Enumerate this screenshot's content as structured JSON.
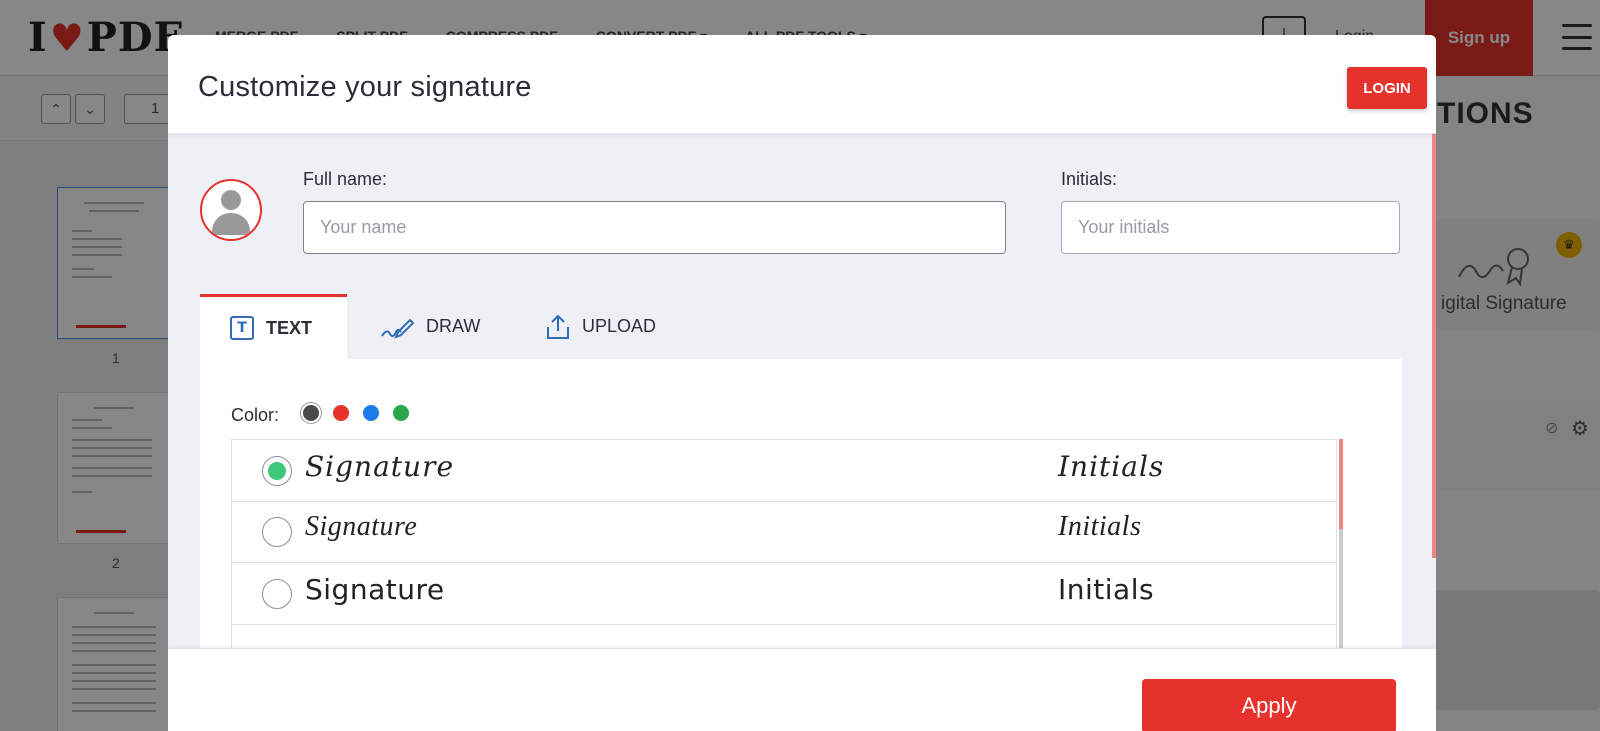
{
  "app": {
    "logo_text_left": "I",
    "logo_text_right": "PDF",
    "nav": [
      "MERGE PDF",
      "SPLIT PDF",
      "COMPRESS PDF",
      "CONVERT PDF ▾",
      "ALL PDF TOOLS ▾"
    ],
    "login_label": "Login",
    "signup_label": "Sign up",
    "accent_color": "#e5322d"
  },
  "viewer": {
    "page_input_value": "1",
    "thumbnails": [
      {
        "number": "1",
        "selected": true
      },
      {
        "number": "2",
        "selected": false
      },
      {
        "number": "",
        "selected": false
      }
    ]
  },
  "right_panel": {
    "title_fragment": "TIONS",
    "card_label": "igital Signature",
    "premium_icon": "crown-icon"
  },
  "modal": {
    "title": "Customize your signature",
    "login_button": "LOGIN",
    "full_name": {
      "label": "Full name:",
      "placeholder": "Your name",
      "value": ""
    },
    "initials": {
      "label": "Initials:",
      "placeholder": "Your initials",
      "value": ""
    },
    "tabs": [
      {
        "label": "TEXT",
        "icon": "text-box-icon",
        "active": true
      },
      {
        "label": "DRAW",
        "icon": "pen-signature-icon",
        "active": false
      },
      {
        "label": "UPLOAD",
        "icon": "upload-icon",
        "active": false
      }
    ],
    "color_label": "Color:",
    "colors": [
      {
        "name": "black",
        "hex": "#4a4a4a",
        "selected": true
      },
      {
        "name": "red",
        "hex": "#e5322d",
        "selected": false
      },
      {
        "name": "blue",
        "hex": "#1e7ae6",
        "selected": false
      },
      {
        "name": "green",
        "hex": "#2aa84a",
        "selected": false
      }
    ],
    "signature_options": [
      {
        "signature": "Signature",
        "initials": "Initials",
        "checked": true
      },
      {
        "signature": "Signature",
        "initials": "Initials",
        "checked": false
      },
      {
        "signature": "Signature",
        "initials": "Initials",
        "checked": false
      }
    ],
    "apply_button": "Apply"
  }
}
